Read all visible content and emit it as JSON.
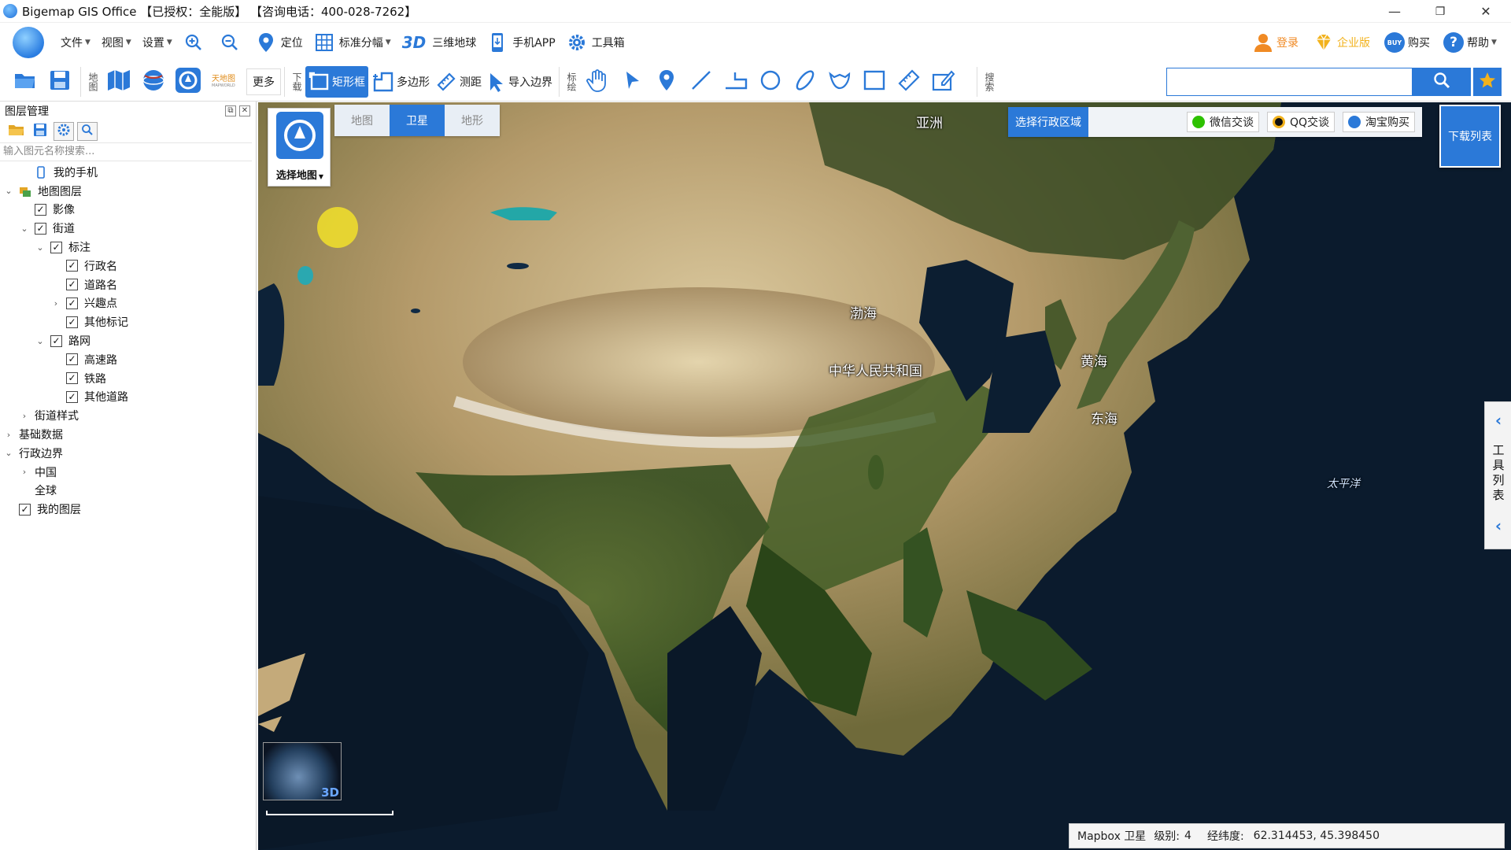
{
  "window": {
    "title": "Bigemap GIS Office 【已授权：全能版】 【咨询电话：400-028-7262】",
    "minimize": "—",
    "restore": "❐",
    "close": "✕"
  },
  "menu": {
    "file": "文件",
    "view": "视图",
    "settings": "设置",
    "locate": "定位",
    "std_sheet": "标准分幅",
    "three_d_prefix": "3D",
    "globe": "三维地球",
    "mobile_app": "手机APP",
    "toolbox": "工具箱",
    "login": "登录",
    "enterprise": "企业版",
    "buy": "购买",
    "buy_badge": "BUY",
    "help": "帮助"
  },
  "toolbar": {
    "map_label": "地图",
    "more": "更多",
    "download_label": "下载",
    "rect": "矩形框",
    "polygon": "多边形",
    "measure": "测距",
    "import_boundary": "导入边界",
    "mark_label": "标绘",
    "search_label": "搜索",
    "search_placeholder": ""
  },
  "layer_panel": {
    "title": "图层管理",
    "search_placeholder": "输入图元名称搜索...",
    "tree": [
      {
        "label": "我的手机",
        "level": 1,
        "arrow": "",
        "check": "none",
        "icon": "phone"
      },
      {
        "label": "地图图层",
        "level": 0,
        "arrow": "⌄",
        "check": "none",
        "icon": "layers"
      },
      {
        "label": "影像",
        "level": 1,
        "arrow": "",
        "check": "checked"
      },
      {
        "label": "街道",
        "level": 1,
        "arrow": "⌄",
        "check": "checked"
      },
      {
        "label": "标注",
        "level": 2,
        "arrow": "⌄",
        "check": "checked"
      },
      {
        "label": "行政名",
        "level": 3,
        "arrow": "",
        "check": "checked"
      },
      {
        "label": "道路名",
        "level": 3,
        "arrow": "",
        "check": "checked"
      },
      {
        "label": "兴趣点",
        "level": 3,
        "arrow": "›",
        "check": "checked"
      },
      {
        "label": "其他标记",
        "level": 3,
        "arrow": "",
        "check": "checked"
      },
      {
        "label": "路网",
        "level": 2,
        "arrow": "⌄",
        "check": "checked"
      },
      {
        "label": "高速路",
        "level": 3,
        "arrow": "",
        "check": "checked"
      },
      {
        "label": "铁路",
        "level": 3,
        "arrow": "",
        "check": "checked"
      },
      {
        "label": "其他道路",
        "level": 3,
        "arrow": "",
        "check": "checked"
      },
      {
        "label": "街道样式",
        "level": 1,
        "arrow": "›",
        "check": "none"
      },
      {
        "label": "基础数据",
        "level": 0,
        "arrow": "›",
        "check": "none"
      },
      {
        "label": "行政边界",
        "level": 0,
        "arrow": "⌄",
        "check": "none"
      },
      {
        "label": "中国",
        "level": 1,
        "arrow": "›",
        "check": "none"
      },
      {
        "label": "全球",
        "level": 1,
        "arrow": "",
        "check": "none"
      },
      {
        "label": "我的图层",
        "level": 0,
        "arrow": "",
        "check": "checked"
      }
    ]
  },
  "map": {
    "select_map": "选择地图",
    "tabs": [
      {
        "label": "地图",
        "active": false
      },
      {
        "label": "卫星",
        "active": true
      },
      {
        "label": "地形",
        "active": false
      }
    ],
    "region_button": "选择行政区域",
    "wechat": "微信交谈",
    "qq": "QQ交谈",
    "taobao": "淘宝购买",
    "download_list": "下载列表",
    "tools_list": "工具列表",
    "globe_3d": "3D",
    "labels": {
      "asia": "亚洲",
      "bohai": "渤海",
      "china": "中华人民共和国",
      "yellow_sea": "黄海",
      "east_sea": "东海",
      "pacific": "太平洋"
    }
  },
  "status": {
    "source": "Mapbox 卫星",
    "level_label": "级别:",
    "level": "4",
    "coord_label": "经纬度:",
    "coords": "62.314453, 45.398450"
  },
  "colors": {
    "accent": "#2b79d8",
    "highlight": "#f2e02a"
  }
}
